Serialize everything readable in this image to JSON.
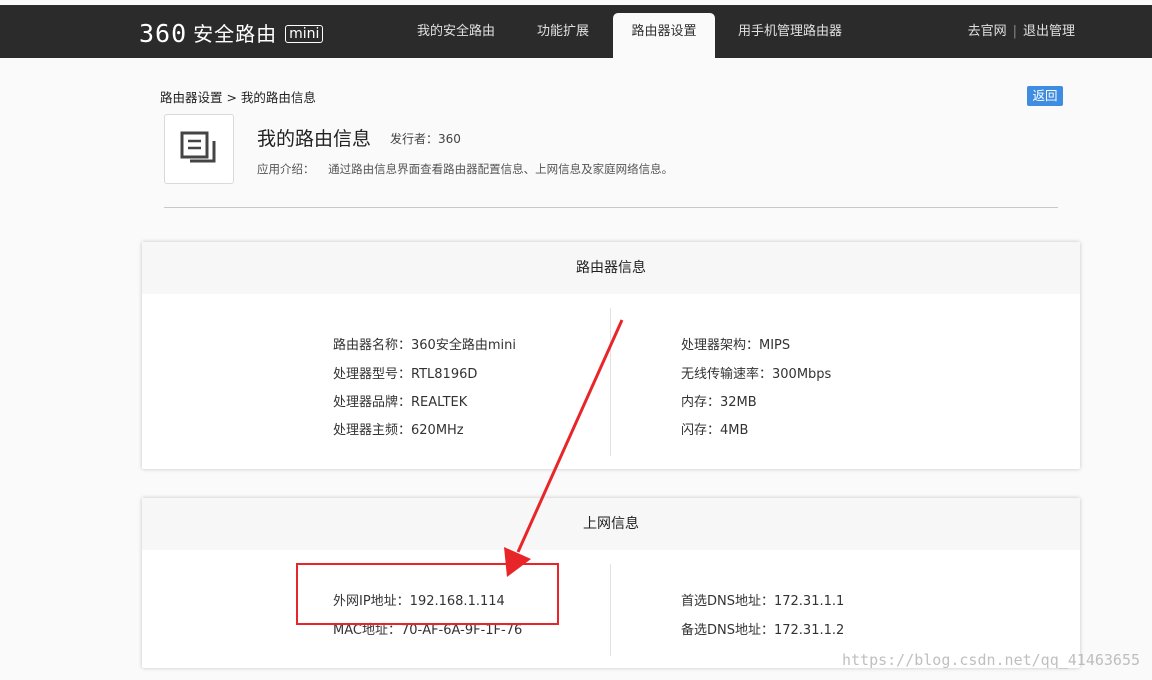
{
  "brand": {
    "number": "360",
    "name": "安全路由",
    "badge": "mini"
  },
  "nav": {
    "items": [
      "我的安全路由",
      "功能扩展",
      "路由器设置",
      "用手机管理路由器"
    ],
    "active_index": 2,
    "official_site": "去官网",
    "separator": "|",
    "logout": "退出管理"
  },
  "breadcrumb": "路由器设置 > 我的路由信息",
  "back_label": "返回",
  "app": {
    "icon": "document-copy-icon",
    "title": "我的路由信息",
    "publisher": "发行者：360",
    "intro_label": "应用介绍：",
    "intro_text": "通过路由信息界面查看路由器配置信息、上网信息及家庭网络信息。"
  },
  "router_info": {
    "title": "路由器信息",
    "left": [
      "路由器名称：360安全路由mini",
      "处理器型号：RTL8196D",
      "处理器品牌：REALTEK",
      "处理器主频：620MHz"
    ],
    "right": [
      "处理器架构：MIPS",
      "无线传输速率：300Mbps",
      "内存：32MB",
      "闪存：4MB"
    ]
  },
  "net_info": {
    "title": "上网信息",
    "left": [
      "外网IP地址：192.168.1.114",
      "MAC地址：70-AF-6A-9F-1F-76"
    ],
    "right": [
      "首选DNS地址：172.31.1.1",
      "备选DNS地址：172.31.1.2"
    ]
  },
  "annotation": {
    "color": "#e8262a"
  },
  "watermark": "https://blog.csdn.net/qq_41463655",
  "colors": {
    "navbar": "#2b2b2b",
    "accent": "#3f8de0",
    "annotation": "#e8262a"
  }
}
